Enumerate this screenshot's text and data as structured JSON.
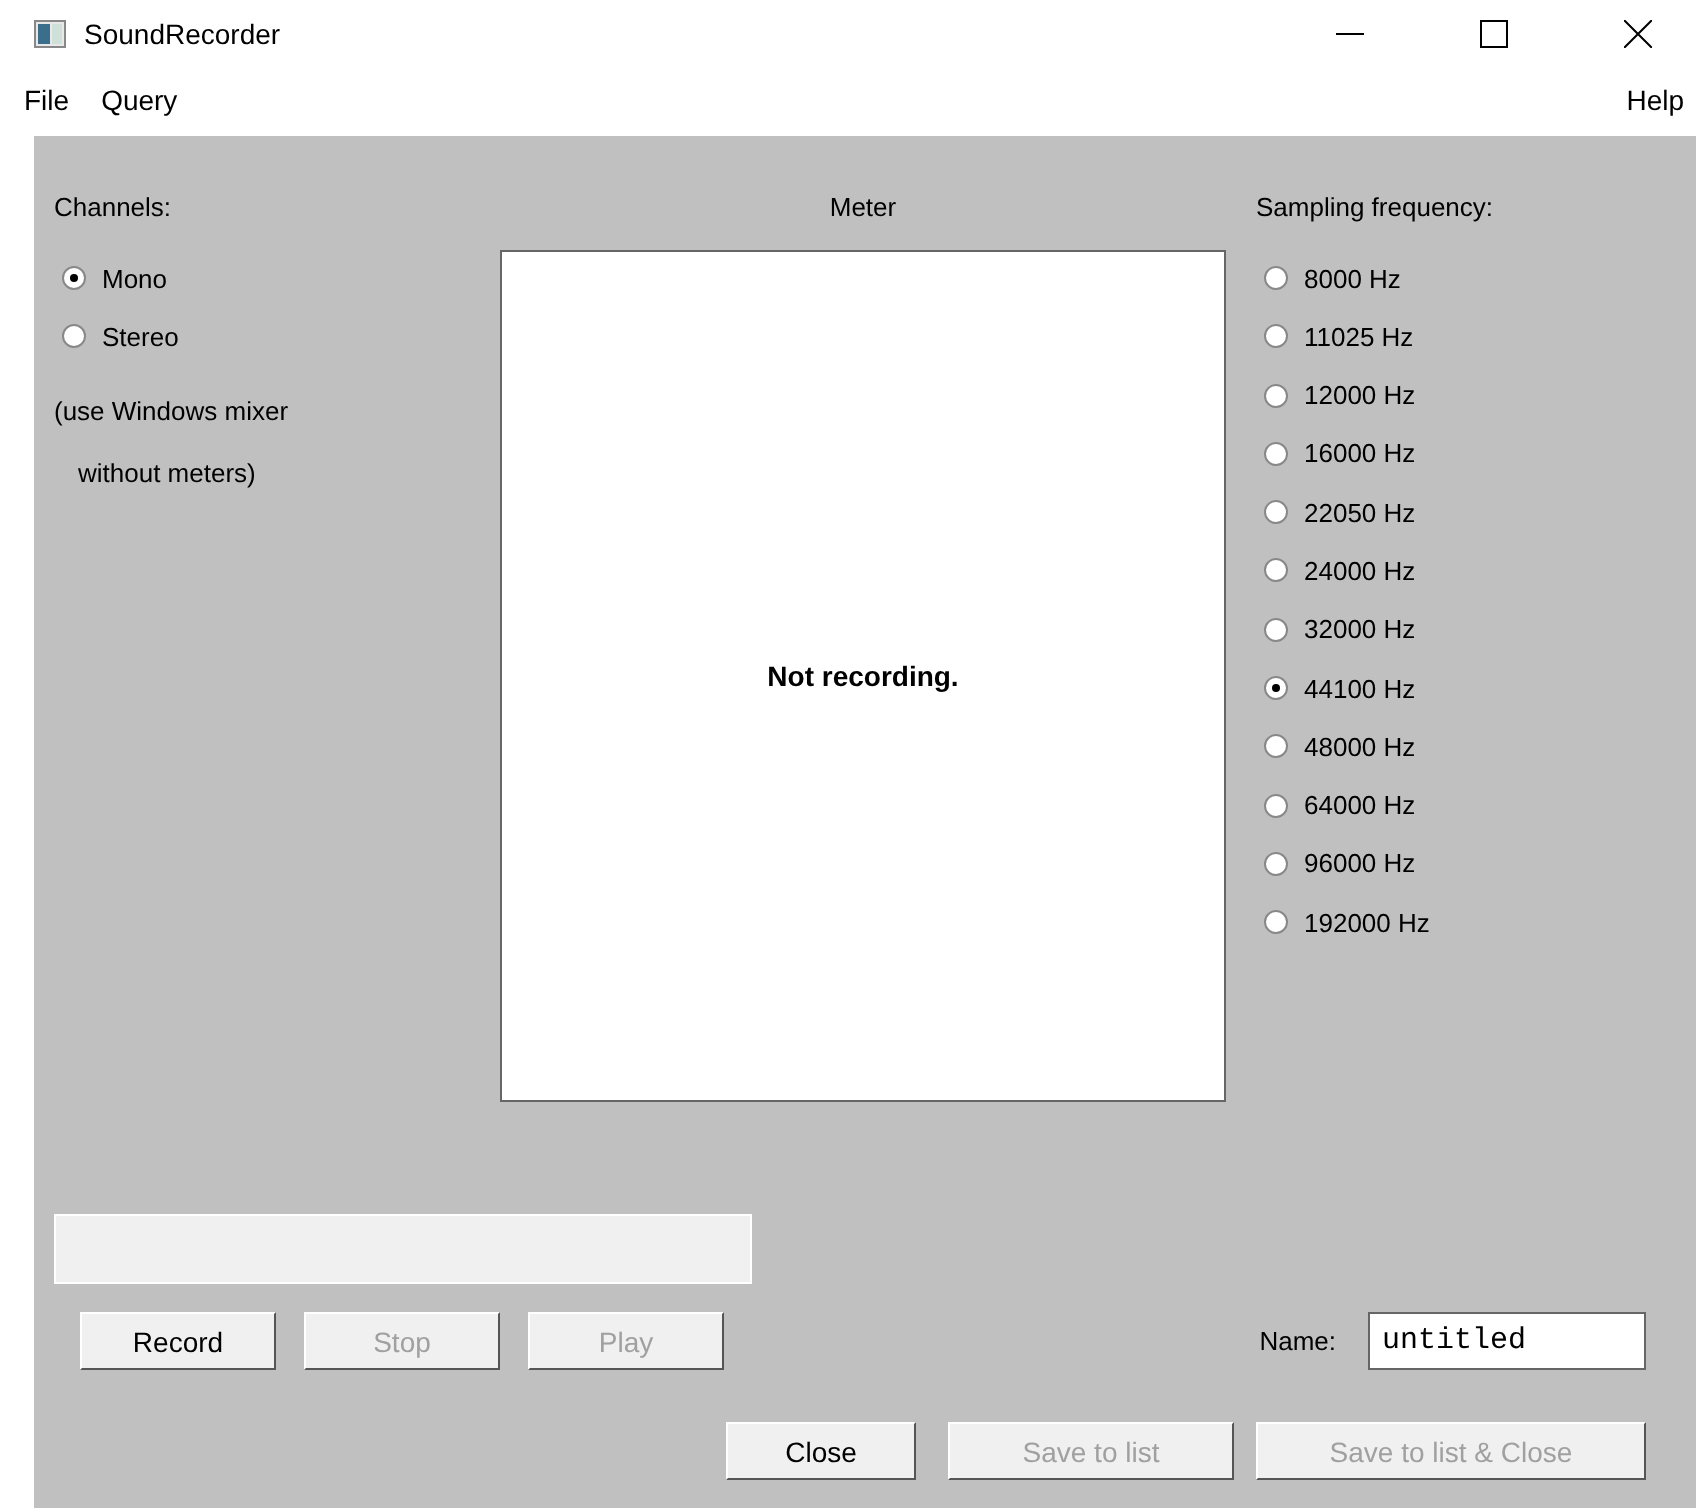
{
  "window": {
    "title": "SoundRecorder"
  },
  "menu": {
    "left": [
      "File",
      "Query"
    ],
    "right": [
      "Help"
    ]
  },
  "channels": {
    "label": "Channels:",
    "options": [
      {
        "label": "Mono",
        "selected": true
      },
      {
        "label": "Stereo",
        "selected": false
      }
    ],
    "note": [
      "(use Windows mixer",
      "without meters)"
    ]
  },
  "meter": {
    "label": "Meter",
    "status": "Not recording."
  },
  "sampling": {
    "label": "Sampling frequency:",
    "options": [
      {
        "label": "8000 Hz",
        "selected": false
      },
      {
        "label": "11025 Hz",
        "selected": false
      },
      {
        "label": "12000 Hz",
        "selected": false
      },
      {
        "label": "16000 Hz",
        "selected": false
      },
      {
        "label": "22050 Hz",
        "selected": false
      },
      {
        "label": "24000 Hz",
        "selected": false
      },
      {
        "label": "32000 Hz",
        "selected": false
      },
      {
        "label": "44100 Hz",
        "selected": true
      },
      {
        "label": "48000 Hz",
        "selected": false
      },
      {
        "label": "64000 Hz",
        "selected": false
      },
      {
        "label": "96000 Hz",
        "selected": false
      },
      {
        "label": "192000 Hz",
        "selected": false
      }
    ]
  },
  "progress": {
    "level": 0
  },
  "transport_buttons": [
    {
      "label": "Record",
      "disabled": false
    },
    {
      "label": "Stop",
      "disabled": true
    },
    {
      "label": "Play",
      "disabled": true
    }
  ],
  "name": {
    "label": "Name:",
    "value": "untitled"
  },
  "bottom_buttons": [
    {
      "label": "Close",
      "disabled": false
    },
    {
      "label": "Save to list",
      "disabled": true
    },
    {
      "label": "Save to list & Close",
      "disabled": true
    }
  ]
}
